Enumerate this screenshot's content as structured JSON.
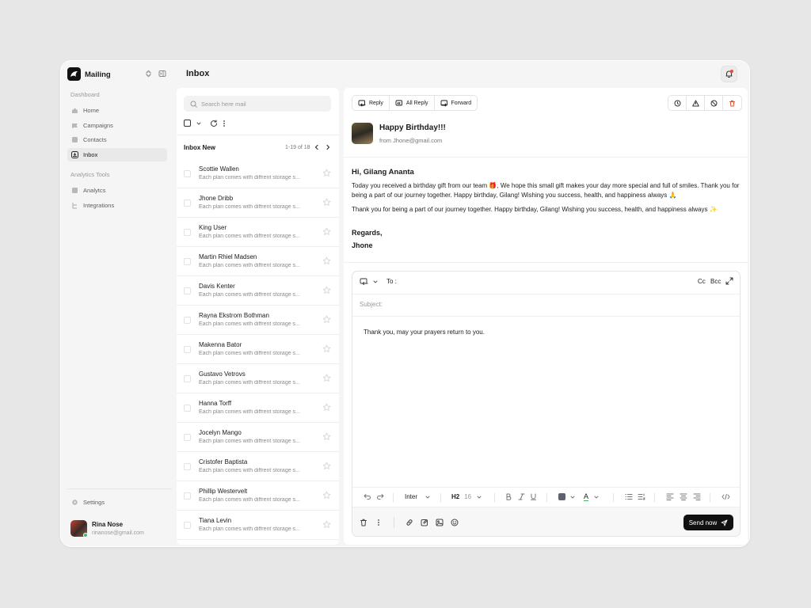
{
  "app": {
    "name": "Mailing"
  },
  "sidebar": {
    "section_dashboard": "Dashboard",
    "section_analytics": "Analytics Tools",
    "nav": [
      {
        "label": "Home",
        "icon": "home-icon"
      },
      {
        "label": "Campaigns",
        "icon": "campaign-icon"
      },
      {
        "label": "Contacts",
        "icon": "contacts-icon"
      },
      {
        "label": "Inbox",
        "icon": "inbox-icon",
        "active": true
      }
    ],
    "tools": [
      {
        "label": "Analytcs",
        "icon": "analytics-icon"
      },
      {
        "label": "Integrations",
        "icon": "integrations-icon"
      }
    ],
    "settings": "Settings",
    "user": {
      "name": "Rina Nose",
      "email": "rinanose@gmail.com"
    }
  },
  "header": {
    "title": "Inbox"
  },
  "list": {
    "search_placeholder": "Search here mail",
    "title": "Inbox New",
    "range": "1-19 of 18",
    "rows": [
      {
        "name": "Scottie Wallen",
        "preview": "Each plan comes with diffrent storage s..."
      },
      {
        "name": "Jhone Dribb",
        "preview": "Each plan comes with diffrent storage s..."
      },
      {
        "name": "King User",
        "preview": "Each plan comes with diffrent storage s..."
      },
      {
        "name": "Martin Rhiel Madsen",
        "preview": "Each plan comes with diffrent storage s..."
      },
      {
        "name": "Davis Kenter",
        "preview": "Each plan comes with diffrent storage s..."
      },
      {
        "name": "Rayna Ekstrom Bothman",
        "preview": "Each plan comes with diffrent storage s..."
      },
      {
        "name": "Makenna Bator",
        "preview": "Each plan comes with diffrent storage s..."
      },
      {
        "name": "Gustavo Vetrovs",
        "preview": "Each plan comes with diffrent storage s..."
      },
      {
        "name": "Hanna Torff",
        "preview": "Each plan comes with diffrent storage s..."
      },
      {
        "name": "Jocelyn Mango",
        "preview": "Each plan comes with diffrent storage s..."
      },
      {
        "name": "Cristofer Baptista",
        "preview": "Each plan comes with diffrent storage s..."
      },
      {
        "name": "Phillip Westervelt",
        "preview": "Each plan comes with diffrent storage s..."
      },
      {
        "name": "Tiana Levin",
        "preview": "Each plan comes with diffrent storage s..."
      }
    ]
  },
  "reader": {
    "actions": {
      "reply": "Reply",
      "all_reply": "All Reply",
      "forward": "Forward"
    },
    "subject": "Happy Birthday!!!",
    "from": "from Jhone@gmail.com",
    "greeting": "Hi, Gilang Ananta",
    "body1": "Today you received a birthday gift from our team 🎁, We hope this small gift makes your day more special and full of smiles. Thank you for being a part of our journey together. Happy birthday, Gilang! Wishing you success, health, and happiness always 🙏",
    "body2": "Thank you for being a part of our journey together. Happy birthday, Gilang! Wishing you success, health, and happiness always ✨",
    "regards": "Regards,",
    "signoff": "Jhone"
  },
  "composer": {
    "to_label": "To :",
    "cc": "Cc",
    "bcc": "Bcc",
    "subject_placeholder": "Subject:",
    "body": "Thank you, may your prayers return to you.",
    "font": "Inter",
    "heading": "H2",
    "size": "16",
    "text_color": "#5d6470",
    "highlight_letter": "A",
    "send_label": "Send now"
  },
  "colors": {
    "accent": "#111111",
    "danger": "#e0532f",
    "online": "#3fb96b"
  }
}
